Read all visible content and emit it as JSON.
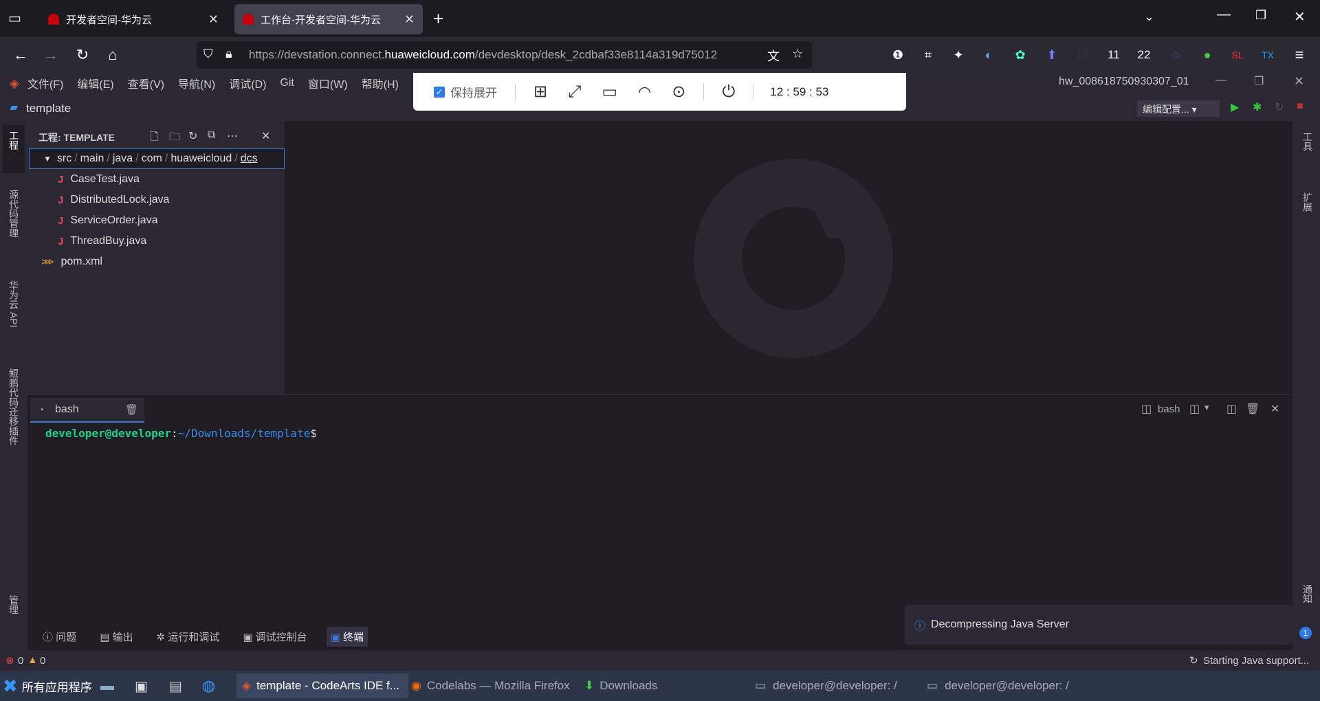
{
  "browser": {
    "tabs": [
      {
        "title": "开发者空间-华为云",
        "active": false
      },
      {
        "title": "工作台-开发者空间-华为云",
        "active": true
      }
    ],
    "url_prefix": "https://devstation.connect.",
    "url_domain": "huaweicloud.com",
    "url_suffix": "/devdesktop/desk_2cdbaf33e8114a319d75012",
    "toolbar_counts": [
      "14",
      "11",
      "22"
    ]
  },
  "overlay": {
    "keep_expanded_label": "保持展开",
    "timer": "12 : 59 : 53"
  },
  "ide": {
    "menus": [
      "文件(F)",
      "编辑(E)",
      "查看(V)",
      "导航(N)",
      "调试(D)",
      "Git",
      "窗口(W)",
      "帮助(H)"
    ],
    "user": "hw_008618750930307_01",
    "project_name": "template",
    "run_config": "编辑配置...",
    "explorer_title": "工程: TEMPLATE",
    "tree": {
      "path_parts": [
        "src",
        "main",
        "java",
        "com",
        "huaweicloud",
        "dcs"
      ],
      "files": [
        "CaseTest.java",
        "DistributedLock.java",
        "ServiceOrder.java",
        "ThreadBuy.java"
      ],
      "pom": "pom.xml"
    },
    "left_labels": [
      "工程",
      "源代码管理",
      "华为云 API",
      "鲲鹏代码迁移插件",
      "管理"
    ],
    "right_labels": [
      "工具",
      "扩展",
      "通知"
    ],
    "terminal": {
      "tab": "bash",
      "right_label": "bash",
      "prompt_user": "developer@developer",
      "prompt_path": "~/Downloads/template"
    },
    "bottom_tabs": [
      "问题",
      "输出",
      "运行和调试",
      "调试控制台",
      "终端"
    ],
    "notification": "Decompressing Java Server",
    "status": {
      "errors": "0",
      "warnings": "0",
      "right": "Starting Java support..."
    }
  },
  "taskbar": {
    "start": "所有应用程序",
    "tasks": [
      "template - CodeArts IDE f...",
      "Codelabs — Mozilla Firefox",
      "Downloads",
      "developer@developer: /",
      "developer@developer: /"
    ]
  }
}
